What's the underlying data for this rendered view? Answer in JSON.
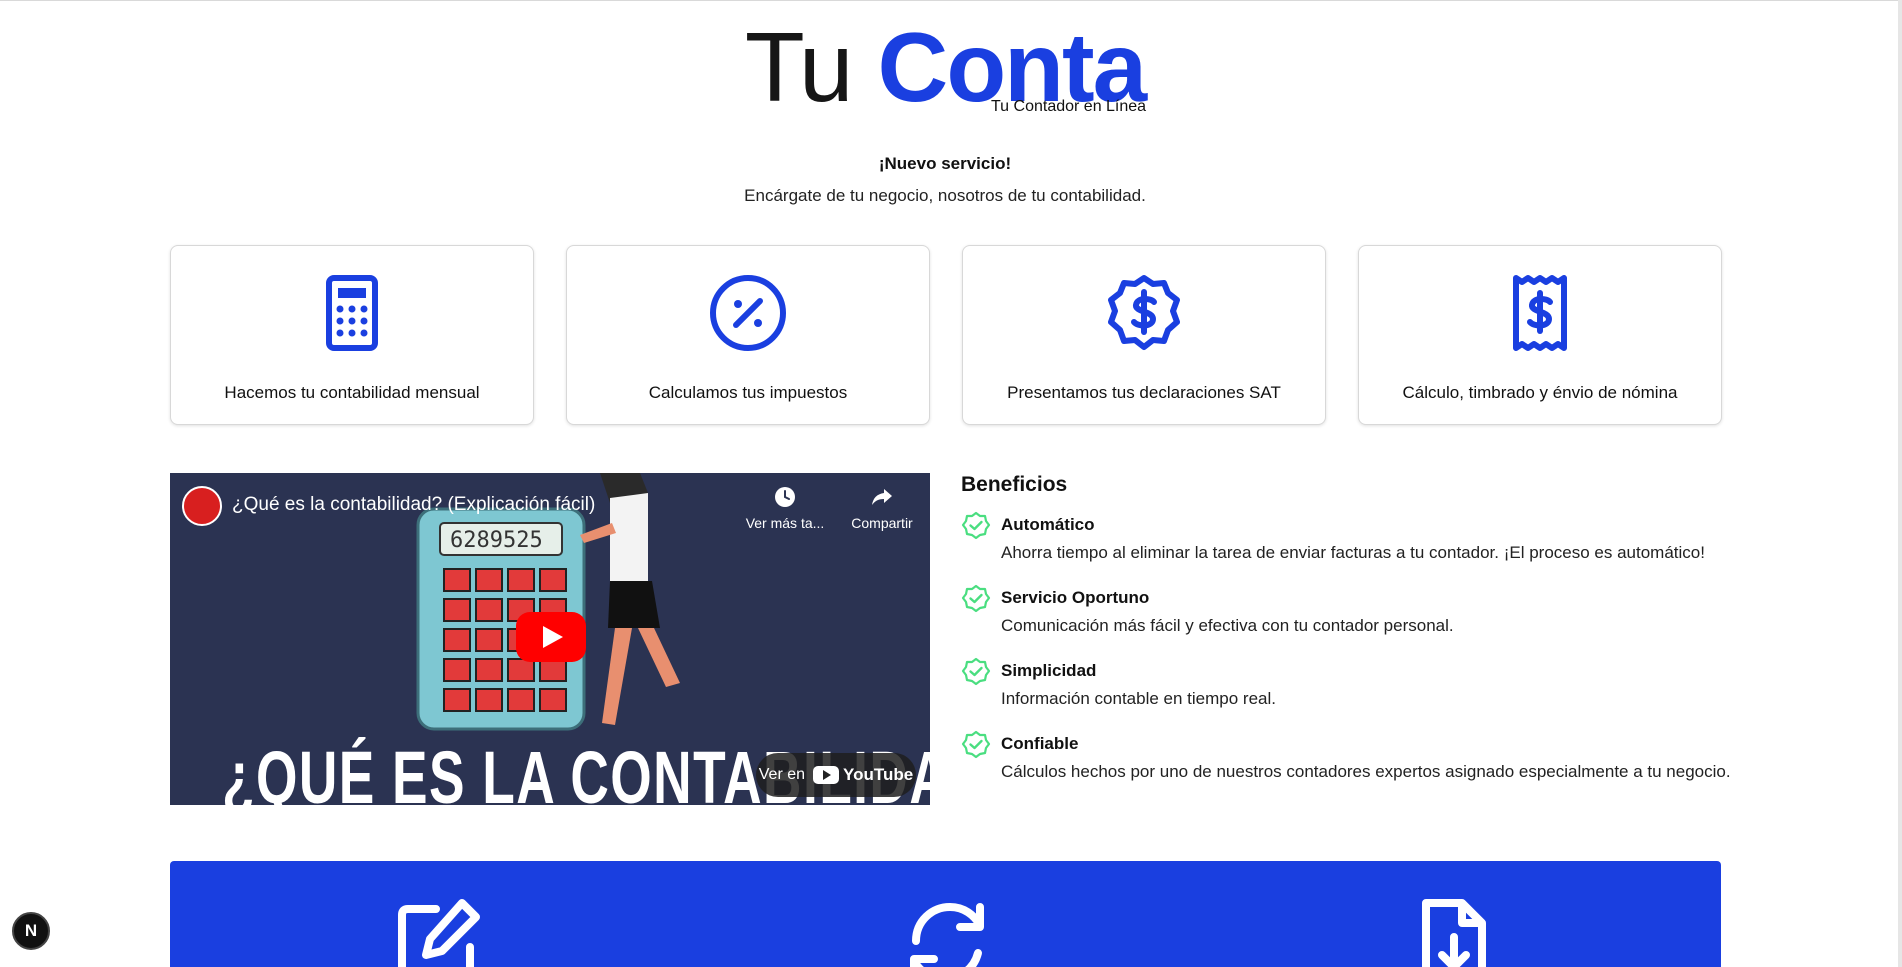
{
  "brand": {
    "word1": "Tu",
    "word2": "Conta",
    "subtitle": "Tu Contador en Línea",
    "accent_color": "#1a3fe0"
  },
  "announcement": {
    "title": "¡Nuevo servicio!",
    "text": "Encárgate de tu negocio, nosotros de tu contabilidad."
  },
  "services": [
    {
      "icon": "calculator-icon",
      "label": "Hacemos tu contabilidad mensual"
    },
    {
      "icon": "percent-circle-icon",
      "label": "Calculamos tus impuestos"
    },
    {
      "icon": "dollar-badge-icon",
      "label": "Presentamos tus declaraciones SAT"
    },
    {
      "icon": "receipt-dollar-icon",
      "label": "Cálculo, timbrado y énvio de nómina"
    }
  ],
  "video": {
    "title": "¿Qué es la contabilidad? (Explicación fácil)",
    "watch_later": "Ver más ta...",
    "share": "Compartir",
    "watch_on": "Ver en",
    "youtube": "YouTube",
    "overlay_text": "¿QUÉ ES LA CONTABILIDAD",
    "display_number": "6289525"
  },
  "benefits": {
    "heading": "Beneficios",
    "items": [
      {
        "title": "Automático",
        "desc": "Ahorra tiempo al eliminar la tarea de enviar facturas a tu contador. ¡El proceso es automático!"
      },
      {
        "title": "Servicio Oportuno",
        "desc": "Comunicación más fácil y efectiva con tu contador personal."
      },
      {
        "title": "Simplicidad",
        "desc": "Información contable en tiempo real."
      },
      {
        "title": "Confiable",
        "desc": "Cálculos hechos por uno de nuestros contadores expertos asignado especialmente a tu negocio."
      }
    ],
    "check_color": "#4ade80"
  },
  "bluebar_icons": [
    "edit-icon",
    "refresh-icon",
    "file-download-icon"
  ],
  "dev_badge": "N"
}
